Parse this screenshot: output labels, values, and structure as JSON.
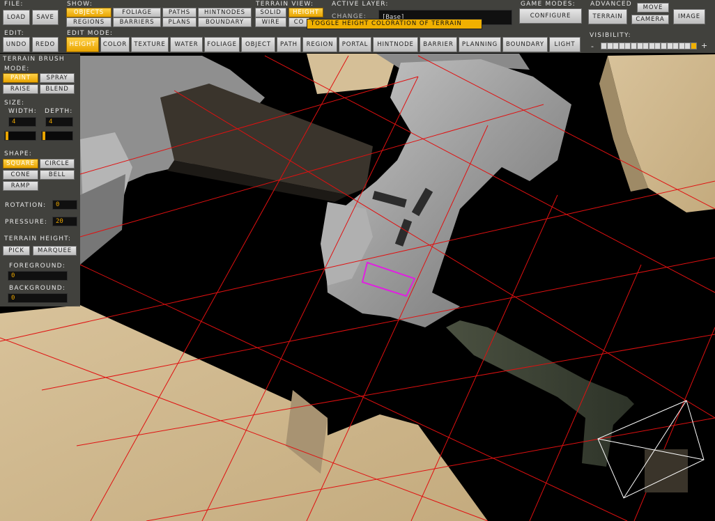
{
  "toolbar": {
    "file": {
      "label": "File:",
      "load": "Load",
      "save": "Save"
    },
    "show": {
      "label": "Show:",
      "objects": "Objects",
      "foliage": "Foliage",
      "paths": "Paths",
      "hintnodes": "HintNodes",
      "regions": "Regions",
      "barriers": "Barriers",
      "plans": "Plans",
      "boundary": "Boundary"
    },
    "terrain_view": {
      "label": "Terrain View:",
      "solid": "Solid",
      "height": "Height",
      "wire": "Wire",
      "color": "Co"
    },
    "active_layer": {
      "label": "Active Layer:",
      "change": "Change:",
      "value": "[Base]"
    },
    "game_modes": {
      "label": "Game Modes:",
      "configure": "Configure"
    },
    "advanced": {
      "label": "Advanced",
      "terrain": "Terrain",
      "move": "Move",
      "camera": "Camera",
      "image": "Image"
    },
    "edit": {
      "label": "Edit:",
      "undo": "Undo",
      "redo": "Redo"
    },
    "edit_mode": {
      "label": "Edit Mode:",
      "height": "Height",
      "color": "Color",
      "texture": "Texture",
      "water": "Water",
      "foliage": "Foliage",
      "object": "Object",
      "path": "Path",
      "region": "Region",
      "portal": "Portal",
      "hintnode": "HintNode",
      "barrier": "Barrier",
      "planning": "Planning",
      "boundary": "Boundary",
      "light": "Light"
    },
    "visibility": {
      "label": "Visibility:",
      "minus": "-",
      "plus": "+",
      "level_index": 15,
      "steps": 16
    }
  },
  "tooltip": "Toggle height coloration of terrain",
  "brush": {
    "title": "Terrain Brush",
    "mode_label": "Mode:",
    "paint": "Paint",
    "spray": "Spray",
    "raise": "Raise",
    "blend": "Blend",
    "size_label": "Size:",
    "width_label": "Width:",
    "depth_label": "Depth:",
    "width": "4",
    "depth": "4",
    "shape_label": "Shape:",
    "square": "Square",
    "circle": "Circle",
    "cone": "Cone",
    "bell": "Bell",
    "ramp": "Ramp",
    "rotation_label": "Rotation:",
    "rotation": "0",
    "pressure_label": "Pressure:",
    "pressure": "20",
    "terrain_height_label": "Terrain Height:",
    "pick": "Pick",
    "marquee": "Marquee",
    "foreground_label": "Foreground:",
    "foreground": "0",
    "background_label": "Background:",
    "background": "0"
  },
  "colors": {
    "accent": "#f0b000",
    "panel": "#46463f",
    "grid": "#e01010"
  }
}
